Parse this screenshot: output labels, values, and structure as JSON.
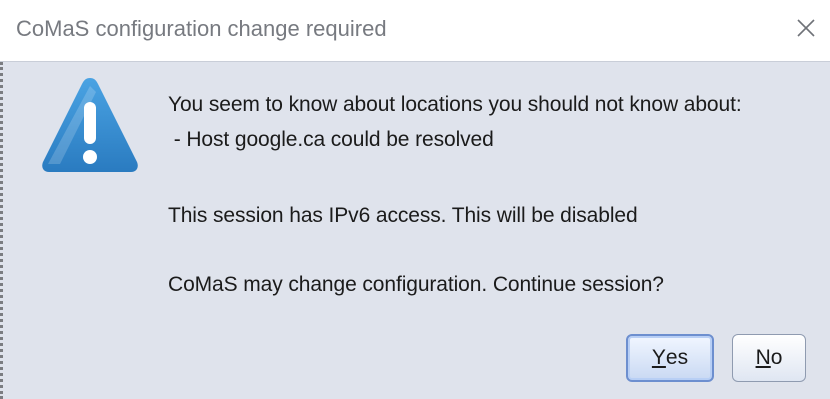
{
  "dialog": {
    "title": "CoMaS configuration change required",
    "close_glyph": "✕",
    "icon": "warning-icon",
    "messages": [
      "You seem to know about locations you should not know about:",
      " - Host google.ca could be resolved",
      "This session has IPv6 access. This will be disabled",
      "CoMaS may change configuration. Continue session?"
    ],
    "buttons": {
      "yes_mnemonic": "Y",
      "yes_rest": "es",
      "no_mnemonic": "N",
      "no_rest": "o"
    }
  },
  "colors": {
    "dialog_bg": "#dfe3ec",
    "title_text": "#777a80",
    "warning_blue": "#3a8fd1"
  }
}
